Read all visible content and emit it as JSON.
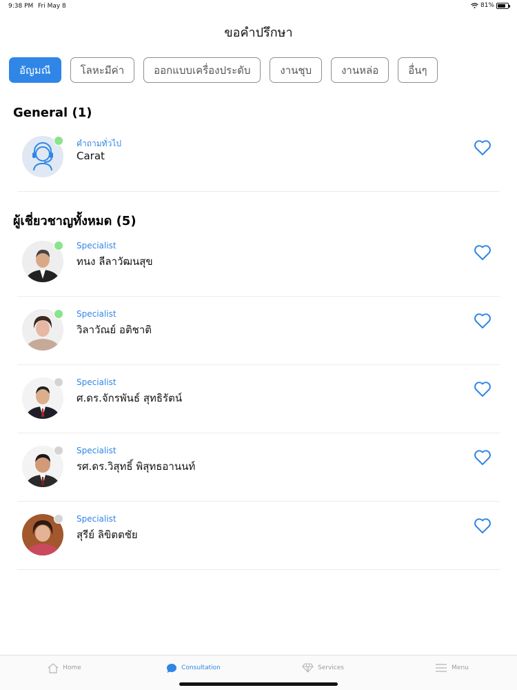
{
  "status_bar": {
    "time": "9:38 PM",
    "date": "Fri May 8",
    "battery": "81%",
    "battery_level": 0.81
  },
  "nav": {
    "title": "ขอคำปรึกษา"
  },
  "categories": [
    {
      "label": "อัญมณี",
      "active": true
    },
    {
      "label": "โลหะมีค่า",
      "active": false
    },
    {
      "label": "ออกแบบเครื่องประดับ",
      "active": false
    },
    {
      "label": "งานชุบ",
      "active": false
    },
    {
      "label": "งานหล่อ",
      "active": false
    },
    {
      "label": "อื่นๆ",
      "active": false
    }
  ],
  "sections": {
    "general": {
      "title": "General (1)",
      "items": [
        {
          "role": "คำถามทั่วไป",
          "name": "Carat",
          "online": true,
          "icon": "support-agent-icon"
        }
      ]
    },
    "specialists": {
      "title": "ผู้เชี่ยวชาญทั้งหมด (5)",
      "items": [
        {
          "role": "Specialist",
          "name": "ทนง ลีลาวัฒนสุข",
          "online": true
        },
        {
          "role": "Specialist",
          "name": "วิลาวัณย์ อติชาติ",
          "online": true
        },
        {
          "role": "Specialist",
          "name": "ศ.ดร.จักรพันธ์  สุทธิรัตน์",
          "online": false
        },
        {
          "role": "Specialist",
          "name": "รศ.ดร.วิสุทธิ์  พิสุทธอานนท์",
          "online": false
        },
        {
          "role": "Specialist",
          "name": "สุรีย์ ลิขิตตชัย",
          "online": false
        }
      ]
    }
  },
  "tab_bar": [
    {
      "label": "Home",
      "icon": "home-icon",
      "active": false
    },
    {
      "label": "Consultation",
      "icon": "chat-bubble-icon",
      "active": true
    },
    {
      "label": "Services",
      "icon": "diamond-icon",
      "active": false
    },
    {
      "label": "Menu",
      "icon": "menu-icon",
      "active": false
    }
  ],
  "colors": {
    "accent": "#2f86e6",
    "online": "#8be38b",
    "offline": "#d4d4d4"
  }
}
